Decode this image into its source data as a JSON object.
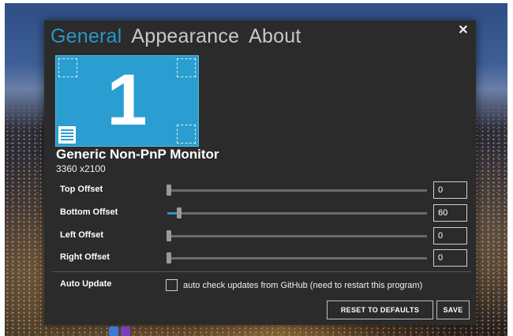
{
  "tabs": [
    {
      "label": "General",
      "active": true
    },
    {
      "label": "Appearance",
      "active": false
    },
    {
      "label": "About",
      "active": false
    }
  ],
  "close_icon": "close-icon",
  "monitor": {
    "number": "1",
    "name": "Generic Non-PnP Monitor",
    "resolution": "3360 x2100",
    "accent_color": "#2a9ed0"
  },
  "offsets": [
    {
      "label": "Top Offset",
      "value": "0",
      "slider_fraction": 0.0
    },
    {
      "label": "Bottom Offset",
      "value": "60",
      "slider_fraction": 0.04
    },
    {
      "label": "Left Offset",
      "value": "0",
      "slider_fraction": 0.0
    },
    {
      "label": "Right Offset",
      "value": "0",
      "slider_fraction": 0.0
    }
  ],
  "auto_update": {
    "label": "Auto Update",
    "checkbox_text": "auto check updates from GitHub (need to restart this program)",
    "checked": false
  },
  "buttons": {
    "reset": "RESET TO DEFAULTS",
    "save": "SAVE"
  },
  "colors": {
    "accent": "#2a96c8",
    "dialog_bg": "#2b2b2b"
  }
}
